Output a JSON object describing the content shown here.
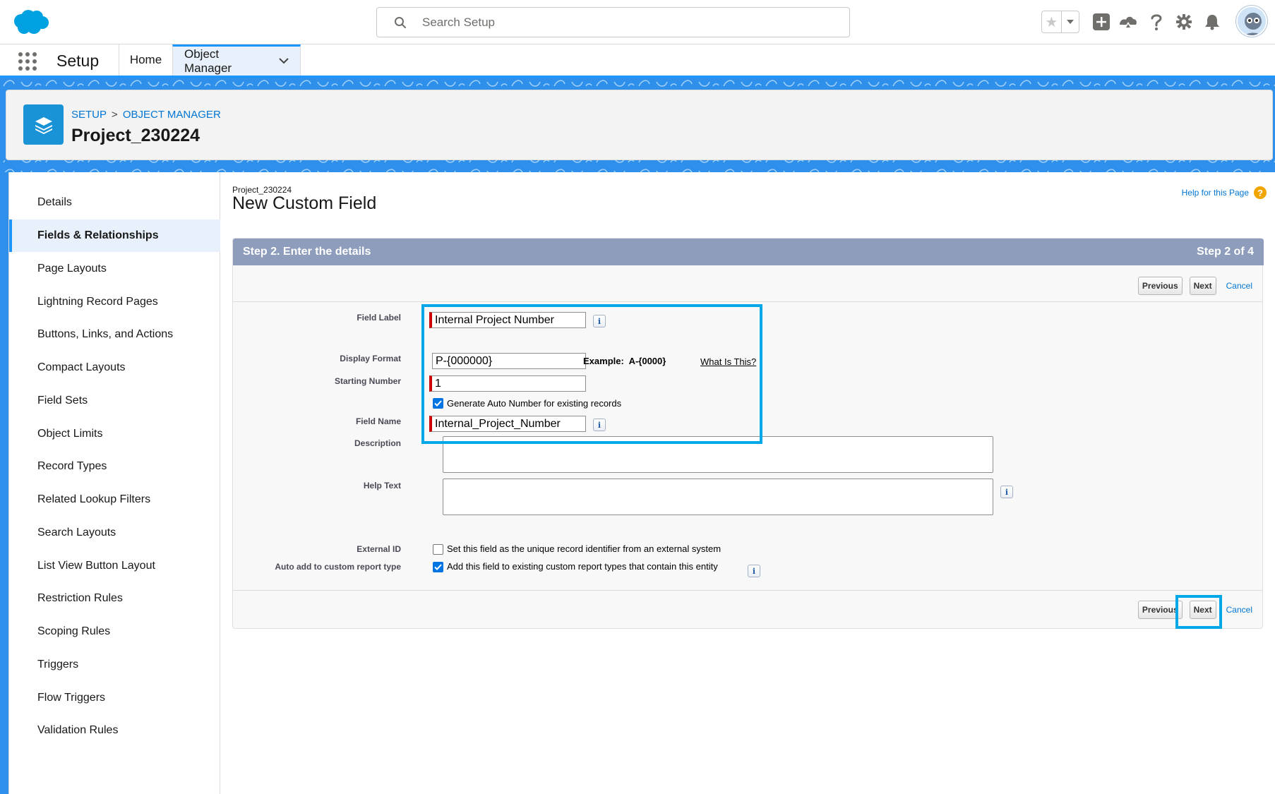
{
  "header": {
    "search_placeholder": "Search Setup",
    "brand_color": "#00a1e0",
    "icons": [
      "favorites-star-icon",
      "favorites-dropdown-icon",
      "global-actions-add-icon",
      "trailhead-icon",
      "help-icon",
      "setup-gear-icon",
      "notifications-bell-icon",
      "user-avatar"
    ]
  },
  "context_bar": {
    "app_name": "Setup",
    "tabs": [
      {
        "label": "Home",
        "active": false
      },
      {
        "label": "Object Manager",
        "active": true
      }
    ]
  },
  "object_header": {
    "breadcrumb": [
      "SETUP",
      "OBJECT MANAGER"
    ],
    "breadcrumb_sep": ">",
    "title": "Project_230224"
  },
  "sidebar": {
    "items": [
      {
        "label": "Details"
      },
      {
        "label": "Fields & Relationships",
        "active": true
      },
      {
        "label": "Page Layouts"
      },
      {
        "label": "Lightning Record Pages"
      },
      {
        "label": "Buttons, Links, and Actions"
      },
      {
        "label": "Compact Layouts"
      },
      {
        "label": "Field Sets"
      },
      {
        "label": "Object Limits"
      },
      {
        "label": "Record Types"
      },
      {
        "label": "Related Lookup Filters"
      },
      {
        "label": "Search Layouts"
      },
      {
        "label": "List View Button Layout"
      },
      {
        "label": "Restriction Rules"
      },
      {
        "label": "Scoping Rules"
      },
      {
        "label": "Triggers"
      },
      {
        "label": "Flow Triggers"
      },
      {
        "label": "Validation Rules"
      }
    ]
  },
  "page": {
    "object_name": "Project_230224",
    "title": "New Custom Field",
    "help_link": "Help for this Page",
    "help_icon": "?"
  },
  "step": {
    "title": "Step 2. Enter the details",
    "counter": "Step 2 of 4",
    "previous_label": "Previous",
    "next_label": "Next",
    "cancel_label": "Cancel"
  },
  "form": {
    "field_label": {
      "label": "Field Label",
      "value": "Internal Project Number",
      "required": true
    },
    "display_format": {
      "label": "Display Format",
      "value": "P-{000000}",
      "example_prefix": "Example:",
      "example_value": "A-{0000}",
      "what_is_this": "What Is This?"
    },
    "starting_number": {
      "label": "Starting Number",
      "value": "1",
      "required": true
    },
    "generate_auto_number": {
      "label": "Generate Auto Number for existing records",
      "checked": true
    },
    "field_name": {
      "label": "Field Name",
      "value": "Internal_Project_Number",
      "required": true
    },
    "description": {
      "label": "Description",
      "value": ""
    },
    "help_text": {
      "label": "Help Text",
      "value": ""
    },
    "external_id": {
      "label": "External ID",
      "checkbox_label": "Set this field as the unique record identifier from an external system",
      "checked": false
    },
    "auto_add_report": {
      "label": "Auto add to custom report type",
      "checkbox_label": "Add this field to existing custom report types that contain this entity",
      "checked": true
    },
    "info_icon": "i"
  },
  "colors": {
    "step_header_bg": "#8e9dbb",
    "highlight": "#00a8e8",
    "link": "#0176d3",
    "required": "#cc0000"
  }
}
